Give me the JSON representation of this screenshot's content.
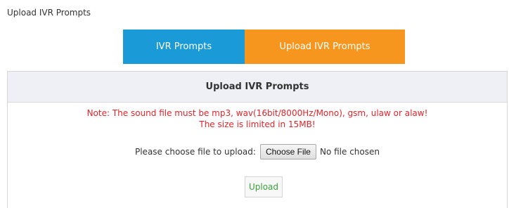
{
  "page": {
    "title": "Upload IVR Prompts"
  },
  "tabs": [
    {
      "label": "IVR Prompts",
      "color": "#1a9ad6"
    },
    {
      "label": "Upload IVR Prompts",
      "color": "#f7961e",
      "active": true
    }
  ],
  "panel": {
    "header": "Upload IVR Prompts",
    "note_line1": "Note: The sound file must be mp3, wav(16bit/8000Hz/Mono), gsm, ulaw or alaw!",
    "note_line2": "The size is limited in 15MB!",
    "file_label": "Please choose file to upload:",
    "choose_button": "Choose File",
    "file_status": "No file chosen",
    "upload_button": "Upload"
  },
  "colors": {
    "note": "#e8242a",
    "upload_text": "#3aa13a",
    "header_bg": "#eef0f5"
  }
}
